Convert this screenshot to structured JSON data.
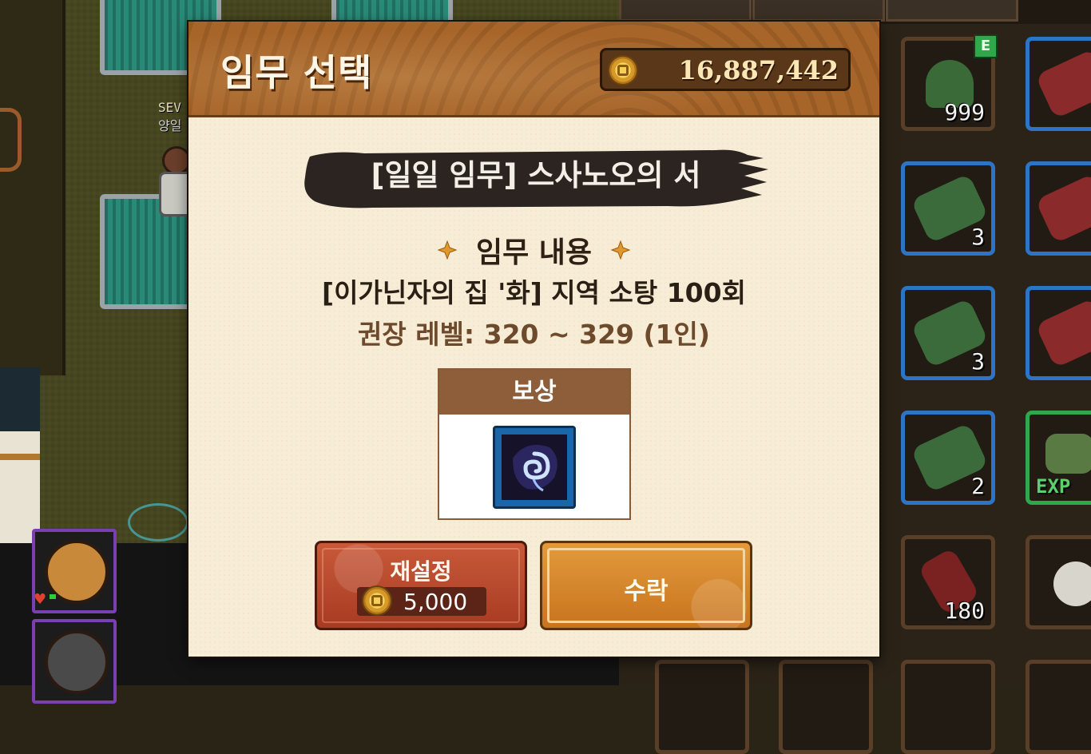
{
  "background": {
    "npc_name_line1": "SEV",
    "npc_name_line2": "양일",
    "inventory_counts": [
      "999",
      "3",
      "3",
      "2",
      "180"
    ],
    "inventory_equip_badge": "E",
    "inventory_exp_label": "EXP"
  },
  "dialog": {
    "title": "임무 선택",
    "currency_icon": "gold-coin-icon",
    "currency_amount": "16,887,442",
    "quest_title": "[일일 임무] 스사노오의 서",
    "section_label": "임무 내용",
    "quest_description": "[이가닌자의 집 '화] 지역 소탕 100회",
    "recommended_level": "권장 레벨: 320 ~ 329 (1인)",
    "reward_header": "보상",
    "reward_item_icon": "blue-spiral-stone-icon",
    "reset_button": {
      "label": "재설정",
      "cost": "5,000"
    },
    "accept_button": {
      "label": "수락"
    }
  },
  "colors": {
    "header_brown": "#a7652a",
    "panel_cream": "#f7ecd6",
    "reset_red": "#b84a2e",
    "accept_orange": "#d8882e",
    "reward_header": "#8e5e3a"
  }
}
